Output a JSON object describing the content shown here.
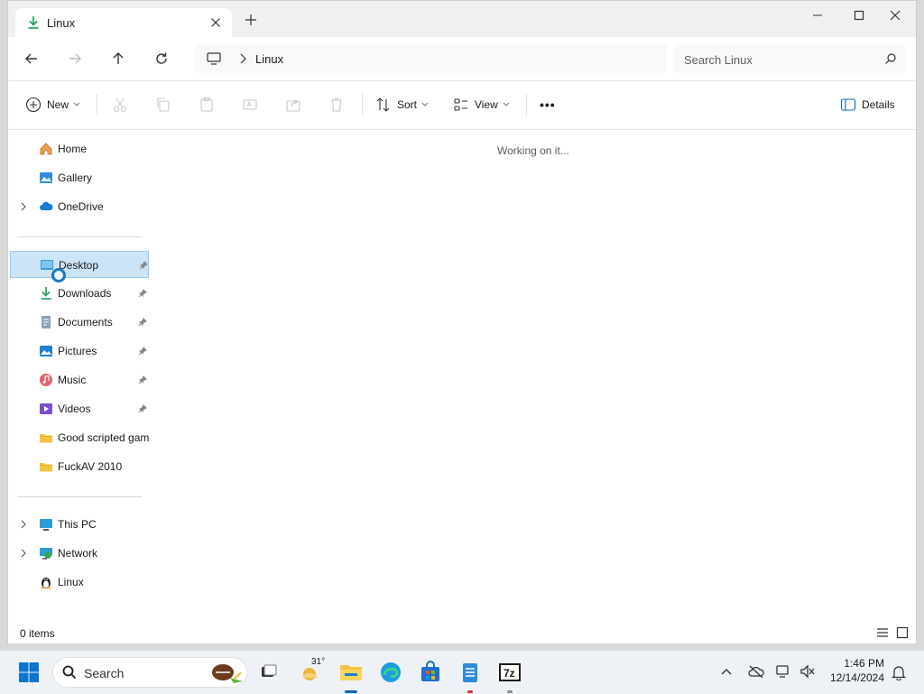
{
  "window": {
    "tab_title": "Linux",
    "controls": {
      "minimize": "minimize",
      "maximize": "maximize",
      "close": "close"
    }
  },
  "address": {
    "breadcrumb": "Linux",
    "search_placeholder": "Search Linux"
  },
  "toolbar": {
    "new_label": "New",
    "sort_label": "Sort",
    "view_label": "View",
    "more_label": "•••",
    "details_label": "Details"
  },
  "nav": {
    "items": [
      {
        "label": "Home",
        "icon": "home-icon"
      },
      {
        "label": "Gallery",
        "icon": "gallery-icon"
      },
      {
        "label": "OneDrive",
        "icon": "cloud-icon"
      },
      {
        "label": "Desktop",
        "icon": "desktop-icon",
        "pinned": true,
        "selected": true
      },
      {
        "label": "Downloads",
        "icon": "download-icon",
        "pinned": true
      },
      {
        "label": "Documents",
        "icon": "documents-icon",
        "pinned": true
      },
      {
        "label": "Pictures",
        "icon": "pictures-icon",
        "pinned": true
      },
      {
        "label": "Music",
        "icon": "music-icon",
        "pinned": true
      },
      {
        "label": "Videos",
        "icon": "videos-icon",
        "pinned": true
      },
      {
        "label": "Good scripted gam",
        "icon": "folder-icon"
      },
      {
        "label": "FuckAV 2010",
        "icon": "folder-icon"
      },
      {
        "label": "This PC",
        "icon": "computer-icon"
      },
      {
        "label": "Network",
        "icon": "network-icon"
      },
      {
        "label": "Linux",
        "icon": "linux-icon"
      }
    ]
  },
  "content": {
    "status": "Working on it..."
  },
  "statusbar": {
    "item_count": "0 items"
  },
  "taskbar": {
    "search_label": "Search",
    "weather_temp": "31°",
    "time": "1:46 PM",
    "date": "12/14/2024"
  },
  "colors": {
    "accent": "#0067c0",
    "selected_bg": "#cce4f7",
    "folder": "#f4c542"
  }
}
